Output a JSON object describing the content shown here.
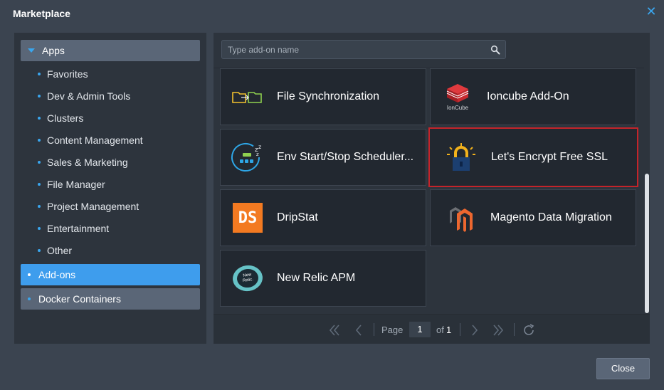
{
  "window": {
    "title": "Marketplace"
  },
  "sidebar": {
    "apps_label": "Apps",
    "app_items": [
      {
        "label": "Favorites"
      },
      {
        "label": "Dev & Admin Tools"
      },
      {
        "label": "Clusters"
      },
      {
        "label": "Content Management"
      },
      {
        "label": "Sales & Marketing"
      },
      {
        "label": "File Manager"
      },
      {
        "label": "Project Management"
      },
      {
        "label": "Entertainment"
      },
      {
        "label": "Other"
      }
    ],
    "addons_label": "Add-ons",
    "docker_label": "Docker Containers"
  },
  "search": {
    "placeholder": "Type add-on name",
    "value": ""
  },
  "addons": [
    {
      "name": "File Synchronization",
      "icon": "folder-sync-icon"
    },
    {
      "name": "Ioncube Add-On",
      "icon": "ioncube-icon",
      "icon_text": "IonCube"
    },
    {
      "name": "Env Start/Stop Scheduler...",
      "icon": "scheduler-icon"
    },
    {
      "name": "Let's Encrypt Free SSL",
      "icon": "lock-icon",
      "selected": true
    },
    {
      "name": "DripStat",
      "icon": "dripstat-icon",
      "icon_text": "DS"
    },
    {
      "name": "Magento Data Migration",
      "icon": "magento-icon"
    },
    {
      "name": "New Relic APM",
      "icon": "new-relic-icon",
      "icon_text": "New Relic."
    }
  ],
  "pager": {
    "page_label": "Page",
    "current": "1",
    "of_label": "of",
    "total": "1"
  },
  "footer": {
    "close_label": "Close"
  },
  "colors": {
    "accent": "#3e9ded",
    "selected_border": "#c4242a",
    "tile_bg": "#222830"
  }
}
